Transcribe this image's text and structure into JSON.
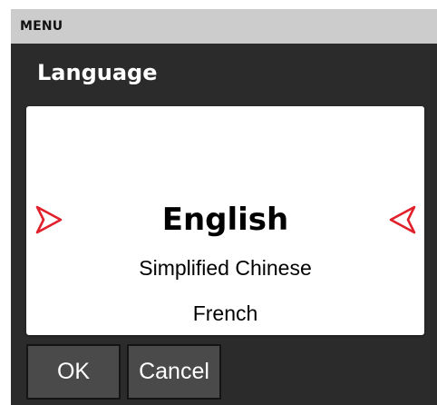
{
  "menu": {
    "label": "MENU"
  },
  "screen": {
    "title": "Language"
  },
  "language_list": {
    "items": [
      "English",
      "Simplified Chinese",
      "French"
    ],
    "selected": "English",
    "prev_icon": "chevron-right-icon",
    "next_icon": "chevron-left-icon",
    "arrow_color": "#e0202a"
  },
  "buttons": {
    "ok_label": "OK",
    "cancel_label": "Cancel"
  }
}
